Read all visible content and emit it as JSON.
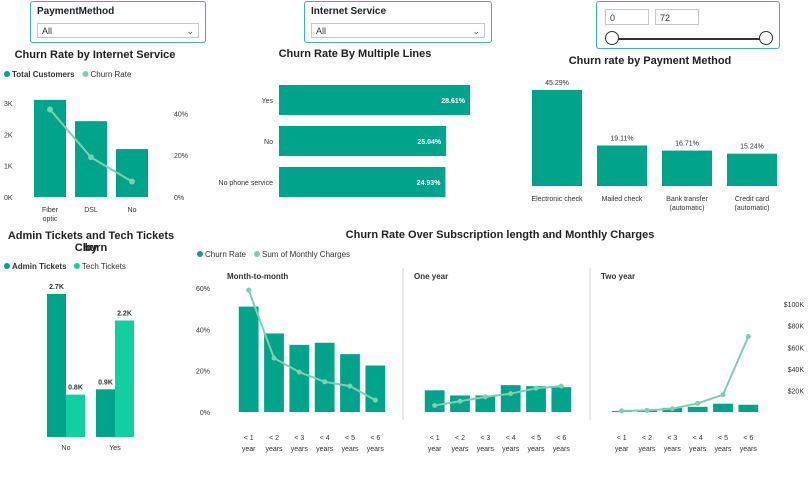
{
  "colors": {
    "bar": "#00a48a",
    "bar_light": "#13cfa0",
    "line": "#7fcfb1",
    "slicer_border": "#41b6a8",
    "dark": "#1a9a86"
  },
  "slicers": {
    "payment": {
      "title": "PaymentMethod",
      "value": "All"
    },
    "internet": {
      "title": "Internet Service",
      "value": "All"
    },
    "tenure": {
      "min": "0",
      "max": "72"
    }
  },
  "charts": {
    "internet": {
      "title": "Churn Rate by Internet Service",
      "legend": [
        "Total Customers",
        "Churn Rate"
      ]
    },
    "lines": {
      "title": "Churn Rate By Multiple Lines"
    },
    "payment": {
      "title": "Churn rate by Payment Method"
    },
    "admin": {
      "title_1": "Admin Tickets and Tech Tickets by",
      "title_2": "Churn",
      "legend": [
        "Admin Tickets",
        "Tech Tickets"
      ]
    },
    "tenure": {
      "title": "Churn Rate Over Subscription length and Monthly Charges",
      "legend": [
        "Churn Rate",
        "Sum of Monthly Charges"
      ],
      "panels": [
        "Month-to-month",
        "One year",
        "Two year"
      ]
    }
  },
  "chart_data": [
    {
      "type": "bar",
      "title": "Churn Rate by Internet Service",
      "categories": [
        "Fiber optic",
        "DSL",
        "No"
      ],
      "series": [
        {
          "name": "Total Customers",
          "values": [
            3100,
            2420,
            1530
          ]
        },
        {
          "name": "Churn Rate",
          "values": [
            41.9,
            19.0,
            7.4
          ]
        }
      ],
      "y_ticks": [
        "0K",
        "1K",
        "2K",
        "3K"
      ],
      "y2_ticks": [
        "0%",
        "20%",
        "40%"
      ]
    },
    {
      "type": "bar",
      "title": "Churn Rate By Multiple Lines",
      "orientation": "horizontal",
      "categories": [
        "Yes",
        "No",
        "No phone service"
      ],
      "values": [
        28.61,
        25.04,
        24.93
      ],
      "labels": [
        "28.61%",
        "25.04%",
        "24.93%"
      ]
    },
    {
      "type": "bar",
      "title": "Churn rate by Payment Method",
      "categories": [
        "Electronic check",
        "Mailed check",
        "Bank transfer (automatic)",
        "Credit card (automatic)"
      ],
      "values": [
        45.29,
        19.11,
        16.71,
        15.24
      ],
      "labels": [
        "45.29%",
        "19.11%",
        "16.71%",
        "15.24%"
      ]
    },
    {
      "type": "bar",
      "title": "Admin Tickets and Tech Tickets by Churn",
      "categories": [
        "No",
        "Yes"
      ],
      "series": [
        {
          "name": "Admin Tickets",
          "values": [
            2700,
            900
          ]
        },
        {
          "name": "Tech Tickets",
          "values": [
            800,
            2200
          ]
        }
      ],
      "labels": [
        [
          "2.7K",
          "0.9K"
        ],
        [
          "0.8K",
          "2.2K"
        ]
      ]
    },
    {
      "type": "bar",
      "title": "Churn Rate Over Subscription length and Monthly Charges",
      "categories": [
        "< 1 year",
        "< 2 years",
        "< 3 years",
        "< 4 years",
        "< 5 years",
        "< 6 years"
      ],
      "y_ticks": [
        "0%",
        "20%",
        "40%",
        "60%"
      ],
      "y2_ticks": [
        "$20K",
        "$40K",
        "$60K",
        "$80K",
        "$100K"
      ],
      "panels": [
        {
          "name": "Month-to-month",
          "churn": [
            51,
            38,
            32.5,
            33.5,
            28,
            22.5
          ],
          "charges": [
            113000,
            50000,
            37000,
            28000,
            24000,
            11000
          ]
        },
        {
          "name": "One year",
          "churn": [
            10.5,
            8,
            8,
            13,
            12.5,
            12
          ],
          "charges": [
            6000,
            10000,
            14000,
            17000,
            22000,
            24000
          ]
        },
        {
          "name": "Two year",
          "churn": [
            0.5,
            1,
            2,
            2.5,
            4,
            3.5
          ],
          "charges": [
            1000,
            1500,
            3000,
            8000,
            16000,
            70000
          ]
        }
      ]
    }
  ]
}
